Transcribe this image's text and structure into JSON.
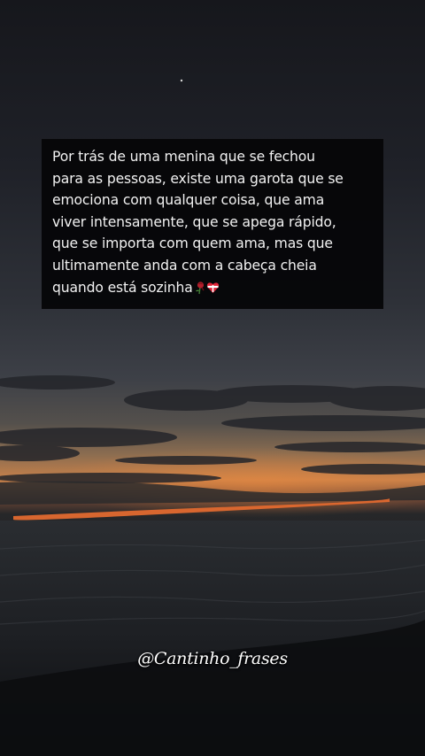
{
  "quote": {
    "lines": [
      "Por trás de uma menina que se fechou",
      "para as pessoas, existe uma garota que se",
      "emociona com qualquer coisa, que ama",
      "viver intensamente, que se apega rápido,",
      "que se importa com quem ama, mas que",
      "ultimamente anda com a cabeça cheia",
      "quando está sozinha"
    ],
    "trailing_emojis": [
      "wilted-rose-icon",
      "heart-with-ribbon-icon"
    ]
  },
  "watermark": {
    "handle": "@Cantinho_frases"
  },
  "colors": {
    "sky_top": "#1c1e25",
    "sky_mid": "#3b3f47",
    "horizon_glow": "#e2793a",
    "sea": "#202327",
    "box_bg": "#060608",
    "text": "#f2f2f2"
  }
}
